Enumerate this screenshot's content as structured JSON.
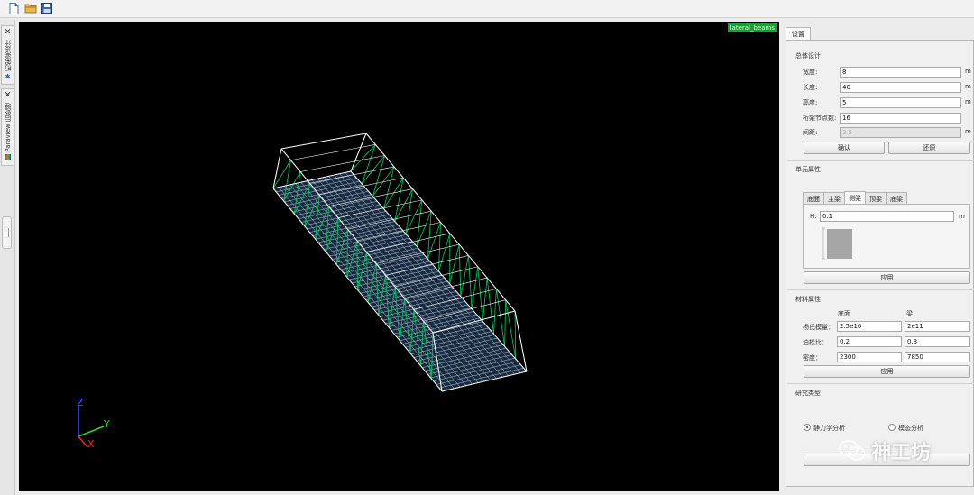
{
  "toolbar": {
    "icons": [
      "new-file-icon",
      "open-folder-icon",
      "save-icon"
    ]
  },
  "left_tabs": [
    {
      "label": "桁架梁设计",
      "icon": "truss-icon"
    },
    {
      "label": "Paraview 后处理",
      "icon": "paraview-icon"
    }
  ],
  "viewport": {
    "label": "lateral_beams",
    "axes": {
      "x": "X",
      "y": "Y",
      "z": "Z"
    }
  },
  "panel": {
    "tab": "设置",
    "general": {
      "title": "总体设计",
      "fields": [
        {
          "label": "宽度:",
          "value": "8",
          "unit": "m"
        },
        {
          "label": "长度:",
          "value": "40",
          "unit": "m"
        },
        {
          "label": "高度:",
          "value": "5",
          "unit": "m"
        },
        {
          "label": "桁架节点数:",
          "value": "16",
          "unit": ""
        },
        {
          "label": "间距:",
          "value": "2.5",
          "unit": "m",
          "disabled": true
        }
      ],
      "confirm": "确认",
      "restore": "还原"
    },
    "element": {
      "title": "单元属性",
      "tabs": [
        "底面",
        "主梁",
        "侧梁",
        "顶梁",
        "底梁"
      ],
      "active_tab": "侧梁",
      "h_label": "H:",
      "h_value": "0.1",
      "h_unit": "m",
      "apply": "应用"
    },
    "material": {
      "title": "材料属性",
      "col_headers": [
        "底面",
        "梁"
      ],
      "rows": [
        {
          "label": "杨氏模量：",
          "values": [
            "2.5e10",
            "2e11"
          ]
        },
        {
          "label": "泊松比：",
          "values": [
            "0.2",
            "0.3"
          ]
        },
        {
          "label": "密度：",
          "values": [
            "2300",
            "7850"
          ]
        }
      ],
      "apply": "应用"
    },
    "study": {
      "title": "研究类型",
      "options": [
        "静力学分析",
        "模态分析"
      ],
      "selected": "静力学分析"
    }
  },
  "watermark": "神工坊",
  "colors": {
    "viewport_bg": "#000000",
    "frame": "#ffffff",
    "diagonals": "#00d060",
    "deck": "#a8c8f0",
    "label_bg": "#1a9e3a"
  }
}
